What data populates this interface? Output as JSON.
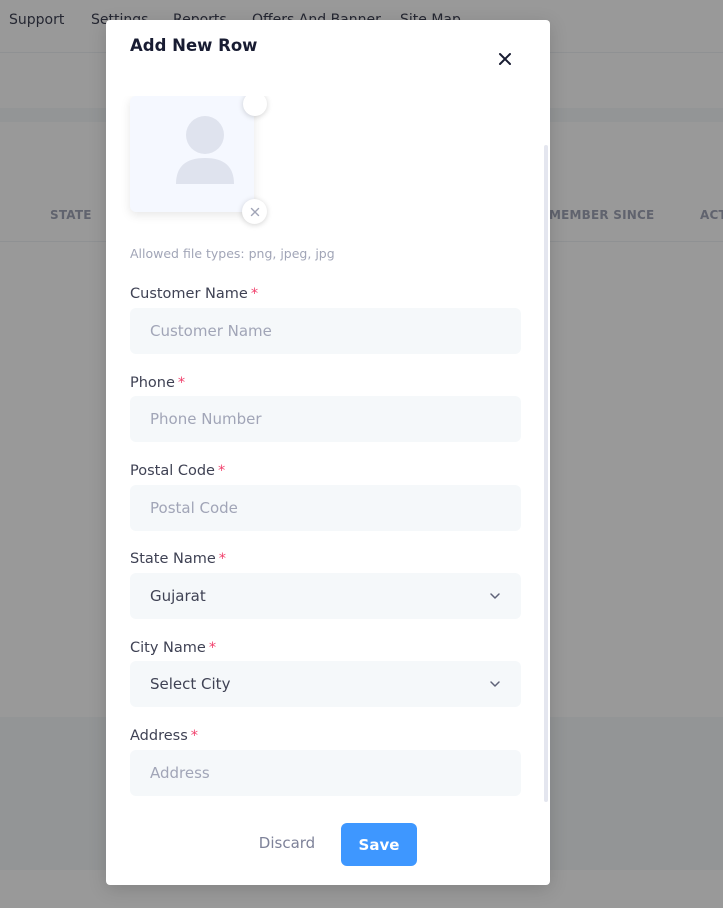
{
  "background": {
    "nav_items": [
      "Support",
      "Settings",
      "Reports",
      "Offers And Banner",
      "Site Map"
    ],
    "table_headers": [
      "STATE",
      "MEMBER SINCE",
      "ACT"
    ]
  },
  "modal": {
    "title": "Add New Row",
    "avatar": {
      "allowed_types": "Allowed file types: png, jpeg, jpg"
    },
    "fields": {
      "customer_name": {
        "label": "Customer Name",
        "required": "*",
        "placeholder": "Customer Name",
        "value": ""
      },
      "phone": {
        "label": "Phone",
        "required": "*",
        "placeholder": "Phone Number",
        "value": ""
      },
      "postal_code": {
        "label": "Postal Code",
        "required": "*",
        "placeholder": "Postal Code",
        "value": ""
      },
      "state_name": {
        "label": "State Name",
        "required": "*",
        "selected": "Gujarat"
      },
      "city_name": {
        "label": "City Name",
        "required": "*",
        "selected": "Select City"
      },
      "address": {
        "label": "Address",
        "required": "*",
        "placeholder": "Address",
        "value": ""
      }
    },
    "actions": {
      "discard": "Discard",
      "save": "Save"
    }
  },
  "colors": {
    "primary": "#3e97ff",
    "required": "#f1416c",
    "field_bg": "#f5f8fa"
  }
}
